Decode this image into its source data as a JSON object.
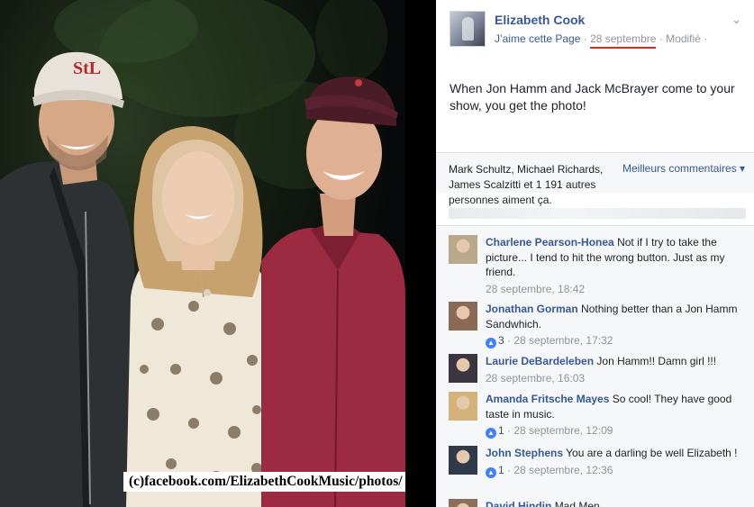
{
  "photo": {
    "watermark": "(c)facebook.com/ElizabethCookMusic/photos/"
  },
  "post": {
    "page_name": "Elizabeth Cook",
    "like_page": "J’aime cette Page",
    "separator": "·",
    "date": "28 septembre",
    "edited": "Modifié",
    "text": "When Jon Hamm and Jack McBrayer come to your show, you get the photo!"
  },
  "likes": {
    "text": "Mark Schultz, Michael Richards, James Scalzitti et 1 191 autres personnes aiment ça.",
    "top_comments": "Meilleurs commentaires ▾"
  },
  "comments": [
    {
      "name": "Charlene Pearson-Honea",
      "text": "Not if I try to take the picture... I tend to hit the wrong button. Just as my friend.",
      "reactions": "",
      "time": "28 septembre, 18:42",
      "avatar_color": "#b9a98a"
    },
    {
      "name": "Jonathan Gorman",
      "text": "Nothing better than a Jon Hamm Sandwhich.",
      "reactions": "3",
      "time": "28 septembre, 17:32",
      "avatar_color": "#8a6a55"
    },
    {
      "name": "Laurie DeBardeleben",
      "text": "Jon Hamm!! Damn girl !!!",
      "reactions": "",
      "time": "28 septembre, 16:03",
      "avatar_color": "#3a3540"
    },
    {
      "name": "Amanda Fritsche Mayes",
      "text": "So cool! They have good taste in music.",
      "reactions": "1",
      "time": "28 septembre, 12:09",
      "avatar_color": "#d4b37a"
    },
    {
      "name": "John Stephens",
      "text": "You are a darling be well Elizabeth !",
      "reactions": "1",
      "time": "28 septembre, 12:36",
      "avatar_color": "#2f3b4a"
    },
    {
      "name": "David Hindin",
      "text": "Mad Men",
      "reactions": "",
      "time": "",
      "avatar_color": "#8c6f5a"
    }
  ],
  "icons": {
    "chevron": "chevron-down-icon",
    "reaction": "like-reaction-icon"
  },
  "colors": {
    "link_blue": "#365899",
    "muted_gray": "#90949c",
    "panel_bg": "#f6f7f9",
    "date_underline": "#d42a2a"
  }
}
